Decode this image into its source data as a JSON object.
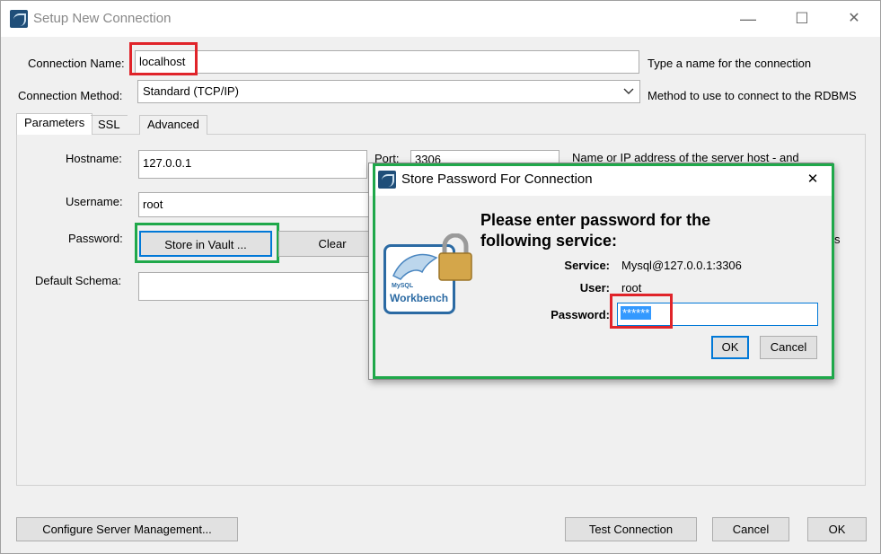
{
  "window": {
    "title": "Setup New Connection",
    "controls": {
      "minimize": "—",
      "maximize": "☐",
      "close": "✕"
    }
  },
  "connection": {
    "name_label": "Connection Name:",
    "name_value": "localhost",
    "name_hint": "Type a name for the connection",
    "method_label": "Connection Method:",
    "method_value": "Standard (TCP/IP)",
    "method_hint": "Method to use to connect to the RDBMS"
  },
  "tabs": [
    {
      "label": "Parameters",
      "active": true
    },
    {
      "label": "SSL",
      "active": false
    },
    {
      "label": "Advanced",
      "active": false
    }
  ],
  "parameters": {
    "hostname_label": "Hostname:",
    "hostname_value": "127.0.0.1",
    "port_label": "Port:",
    "port_value": "3306",
    "host_hint": "Name or IP address of the server host - and",
    "username_label": "Username:",
    "username_value": "root",
    "password_label": "Password:",
    "store_vault_label": "Store in Vault ...",
    "clear_label": "Clear",
    "password_hint_fragment": "s",
    "schema_label": "Default Schema:",
    "schema_value": ""
  },
  "footer": {
    "configure_label": "Configure Server Management...",
    "test_label": "Test Connection",
    "cancel_label": "Cancel",
    "ok_label": "OK"
  },
  "dialog": {
    "title": "Store Password For Connection",
    "close": "✕",
    "heading": "Please enter password for the following service:",
    "service_label": "Service:",
    "service_value": "Mysql@127.0.0.1:3306",
    "user_label": "User:",
    "user_value": "root",
    "password_label": "Password:",
    "password_value": "******",
    "ok_label": "OK",
    "cancel_label": "Cancel",
    "logo_small": "MySQL",
    "logo_text": "Workbench"
  },
  "colors": {
    "highlight_red": "#e0242a",
    "highlight_green": "#1fa84a",
    "focus_blue": "#0078d7",
    "selection_blue": "#3399ff"
  }
}
